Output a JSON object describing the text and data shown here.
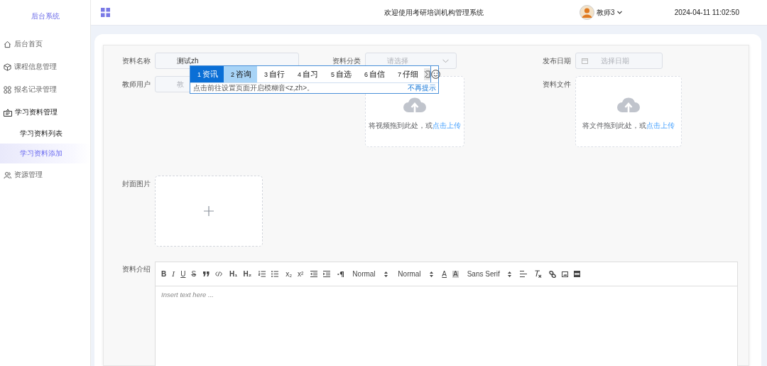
{
  "sidebar": {
    "title": "后台系统",
    "items": [
      {
        "label": "后台首页",
        "selected": false
      },
      {
        "label": "课程信息管理",
        "selected": false
      },
      {
        "label": "报名记录管理",
        "selected": false
      },
      {
        "label": "学习资料管理",
        "selected": false,
        "expanded": true,
        "children": [
          {
            "label": "学习资料列表",
            "selected": false
          },
          {
            "label": "学习资料添加",
            "selected": true
          }
        ]
      },
      {
        "label": "资源管理",
        "selected": false
      }
    ]
  },
  "header": {
    "title": "欢迎使用考研培训机构管理系统",
    "user": "教师3",
    "datetime": "2024-04-11 11:02:50"
  },
  "form": {
    "name": {
      "label": "资料名称",
      "value": "测试zh"
    },
    "category": {
      "label": "资料分类",
      "placeholder": "请选择"
    },
    "date": {
      "label": "发布日期",
      "placeholder": "选择日期"
    },
    "teacher": {
      "label": "教师用户",
      "placeholder": "教"
    },
    "video_upload": {
      "hint": "将视频拖到此处，或",
      "link": "点击上传"
    },
    "file_upload": {
      "label": "资料文件",
      "hint": "将文件拖到此处，或",
      "link": "点击上传"
    },
    "cover": {
      "label": "封面图片"
    },
    "intro": {
      "label": "资料介绍",
      "placeholder": "Insert text here ...",
      "toolbar": {
        "formats": [
          "B",
          "I",
          "U",
          "S"
        ],
        "headers": [
          "H₁",
          "H₂"
        ],
        "scripts": [
          "x₂",
          "x²"
        ],
        "selects": [
          "Normal",
          "Normal",
          "Sans Serif"
        ],
        "colors": [
          "A",
          "A"
        ]
      }
    }
  },
  "ime": {
    "candidates": [
      {
        "index": "1",
        "text": "资讯",
        "selected": true,
        "hovered": false
      },
      {
        "index": "2",
        "text": "咨询",
        "selected": false,
        "hovered": true
      },
      {
        "index": "3",
        "text": "自行",
        "selected": false,
        "hovered": false
      },
      {
        "index": "4",
        "text": "自习",
        "selected": false,
        "hovered": false
      },
      {
        "index": "5",
        "text": "自选",
        "selected": false,
        "hovered": false
      },
      {
        "index": "6",
        "text": "自信",
        "selected": false,
        "hovered": false
      },
      {
        "index": "7",
        "text": "仔细",
        "selected": false,
        "hovered": false
      }
    ],
    "hint": "点击前往设置页面开启模糊音<z,zh>。",
    "dismiss": "不再提示"
  }
}
